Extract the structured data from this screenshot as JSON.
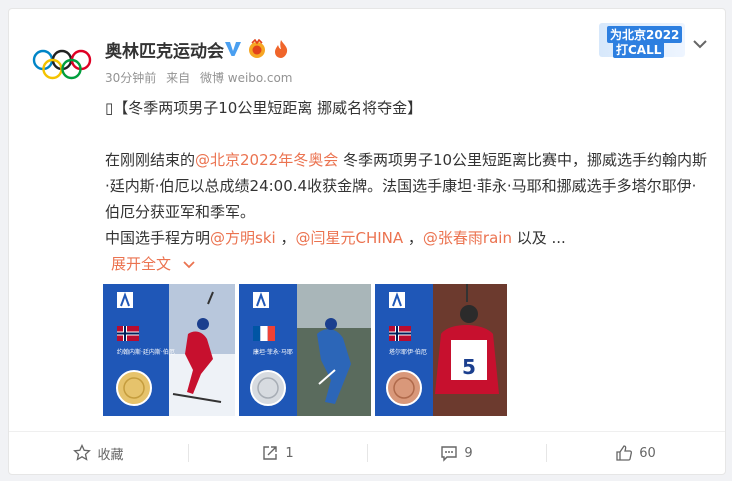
{
  "post": {
    "author": "奥林匹克运动会",
    "time": "30分钟前",
    "source_prefix": "来自",
    "source": "微博 weibo.com",
    "promo_line1": "为北京2022",
    "promo_line2": "打CALL",
    "title_marker": "▯",
    "title": "【冬季两项男子10公里短距离 挪威名将夺金】",
    "para1_a": "在刚刚结束的",
    "mention1": "@北京2022年冬奥会",
    "para1_b": " 冬季两项男子10公里短距离比赛中，挪威选手约翰内斯·廷内斯·伯厄以总成绩24:00.4收获金牌。法国选手康坦·菲永·马耶和挪威选手多塔尔耶伊·伯厄分获亚军和季军。",
    "para2_a": "中国选手程方明",
    "mention2": "@方明ski",
    "sep1": " ，",
    "mention3": "@闫星元CHINA",
    "sep2": " ，",
    "mention4": "@张春雨rain",
    "para2_b": " 以及 ...",
    "expand_label": "展开全文",
    "photos": [
      {
        "caption": "约翰内斯·廷内斯·伯厄",
        "flag": "norway",
        "medal": "gold",
        "bib": ""
      },
      {
        "caption": "康坦·菲永·马耶",
        "flag": "france",
        "medal": "silver",
        "bib": ""
      },
      {
        "caption": "塔尔耶伊·伯厄",
        "flag": "norway",
        "medal": "bronze",
        "bib": "5"
      }
    ]
  },
  "actions": {
    "favorite_label": "收藏",
    "repost_count": "1",
    "comment_count": "9",
    "like_count": "60"
  },
  "colors": {
    "accent": "#eb7350",
    "verified": "#4a9ff0"
  }
}
